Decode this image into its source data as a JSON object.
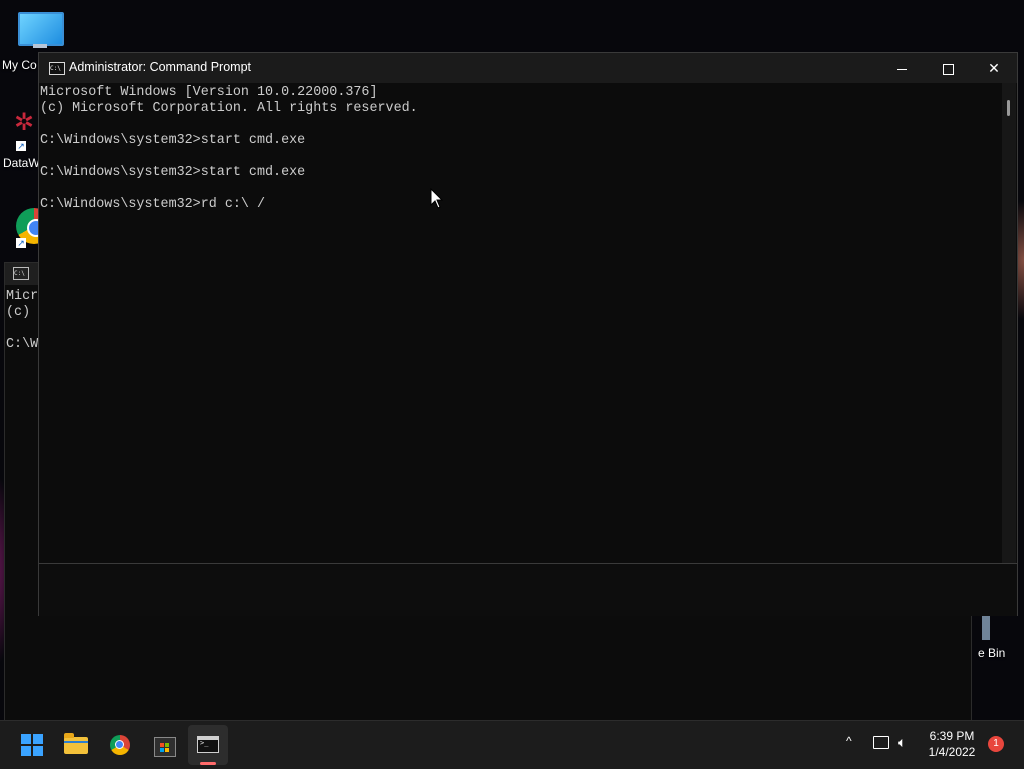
{
  "desktop": {
    "icons": [
      {
        "label": "My Co",
        "icon": "monitor-icon"
      },
      {
        "label": "DataW",
        "icon": "datawin-icon"
      },
      {
        "label": "",
        "icon": "chrome-icon"
      },
      {
        "label": "e Bin",
        "icon": "recycle-bin-icon"
      }
    ]
  },
  "background_window": {
    "text": "Micro\n(c) \n\nC:\\W"
  },
  "window": {
    "title": "Administrator: Command Prompt",
    "icon": "cmd-icon",
    "controls": {
      "minimize": "minimize-icon",
      "maximize": "maximize-icon",
      "close": "close-icon"
    },
    "console_text": "Microsoft Windows [Version 10.0.22000.376]\n(c) Microsoft Corporation. All rights reserved.\n\nC:\\Windows\\system32>start cmd.exe\n\nC:\\Windows\\system32>start cmd.exe\n\nC:\\Windows\\system32>rd c:\\ /"
  },
  "taskbar": {
    "apps": [
      {
        "name": "Start",
        "icon": "windows-logo-icon"
      },
      {
        "name": "File Explorer",
        "icon": "folder-icon"
      },
      {
        "name": "Google Chrome",
        "icon": "chrome-icon"
      },
      {
        "name": "Microsoft Store",
        "icon": "store-icon"
      },
      {
        "name": "Command Prompt",
        "icon": "cmd-icon",
        "active": true
      }
    ],
    "tray": {
      "chevron": "^",
      "time": "6:39 PM",
      "date": "1/4/2022",
      "notifications": "1"
    }
  },
  "colors": {
    "console_bg": "#0c0c0c",
    "console_text": "#cccccc",
    "taskbar_bg": "#1c1c1c",
    "accent": "#3aa3ff",
    "notification_badge": "#e8463d"
  }
}
